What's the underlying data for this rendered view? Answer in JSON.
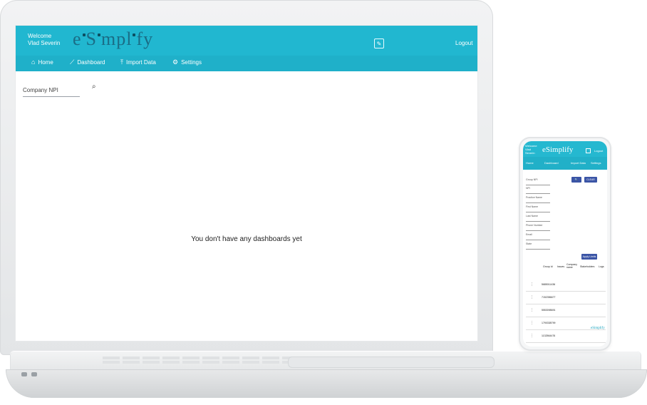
{
  "app": {
    "welcome_line1": "Welcome",
    "welcome_line2": "Vlad Severin",
    "logo_text": "eSimplify",
    "logout": "Logout",
    "nav": [
      {
        "icon": "home-icon",
        "glyph": "⌂",
        "label": "Home"
      },
      {
        "icon": "chart-line-icon",
        "glyph": "⟋",
        "label": "Dashboard"
      },
      {
        "icon": "import-icon",
        "glyph": "⤒",
        "label": "Import Data"
      },
      {
        "icon": "gear-icon",
        "glyph": "⚙",
        "label": "Settings"
      }
    ],
    "search": {
      "placeholder": "Company NPI"
    },
    "empty_message": "You don't have any dashboards yet",
    "colors": {
      "header": "#21b7d0",
      "nav": "#1fb0c9"
    }
  },
  "phone": {
    "welcome_line1": "Welcome",
    "welcome_line2": "Vlad",
    "welcome_line3": "Severin",
    "logo_text": "eSimplify",
    "logout": "Logout",
    "nav": [
      {
        "label": "Home"
      },
      {
        "label": "Dashboard"
      },
      {
        "label": "Import Data"
      },
      {
        "label": "Settings"
      }
    ],
    "fields": [
      "Group NPI",
      "NPI",
      "Practice Name",
      "First Name",
      "Last Name",
      "Phone Number",
      "Email",
      "State"
    ],
    "buttons": {
      "search": "🔍",
      "clear": "CLEAR",
      "apply": "Apply Limits"
    },
    "table": {
      "headers": [
        "Group Id",
        "Issues",
        "Company name",
        "Stakeholders",
        "Logs"
      ],
      "rows": [
        "5685011436",
        "7152356677",
        "5553098691",
        "1790338799",
        "1132564476"
      ]
    },
    "mini_logo": "eSimplify"
  }
}
